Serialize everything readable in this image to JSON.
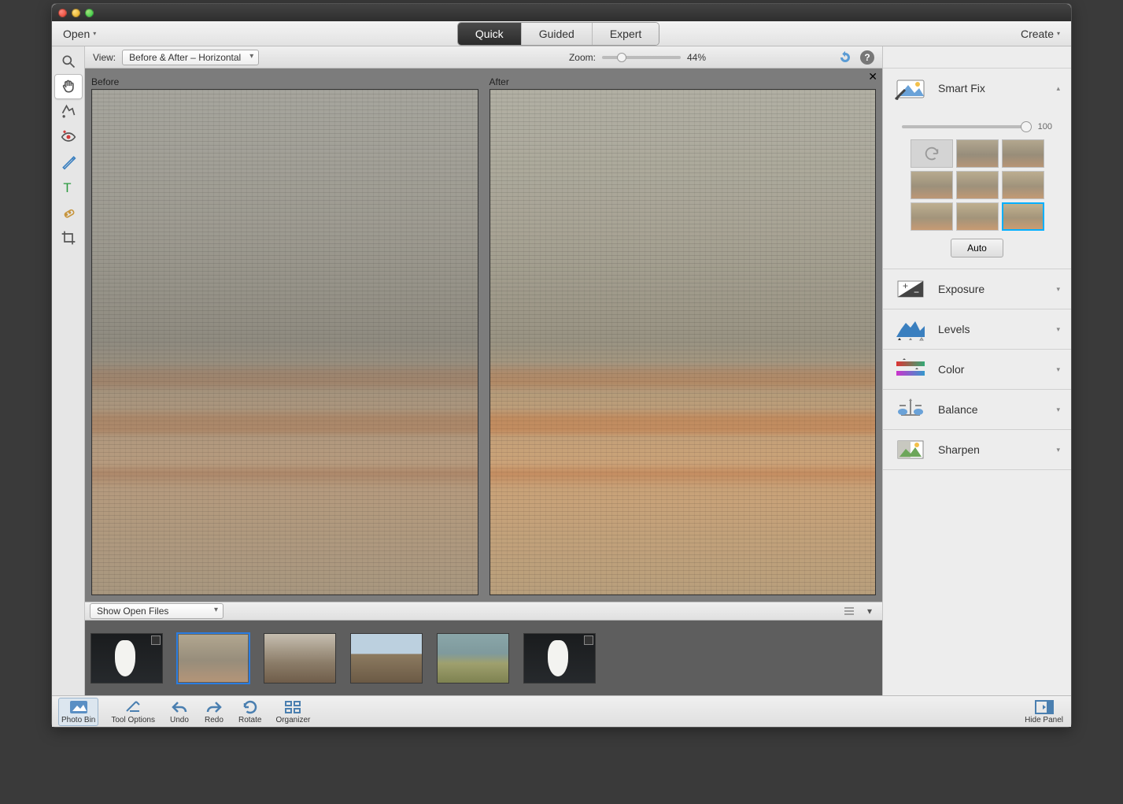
{
  "titlebar": {},
  "menubar": {
    "open_label": "Open",
    "create_label": "Create",
    "mode_tabs": {
      "quick": "Quick",
      "guided": "Guided",
      "expert": "Expert"
    }
  },
  "options_bar": {
    "view_label": "View:",
    "view_value": "Before & After – Horizontal",
    "zoom_label": "Zoom:",
    "zoom_value": "44%"
  },
  "doc": {
    "before_label": "Before",
    "after_label": "After"
  },
  "photo_bin_bar": {
    "filter_value": "Show Open Files"
  },
  "adjustments": {
    "smart_fix": {
      "label": "Smart Fix",
      "slider_value": "100",
      "auto_label": "Auto"
    },
    "exposure": {
      "label": "Exposure"
    },
    "levels": {
      "label": "Levels"
    },
    "color": {
      "label": "Color"
    },
    "balance": {
      "label": "Balance"
    },
    "sharpen": {
      "label": "Sharpen"
    }
  },
  "bottom_bar": {
    "photo_bin": "Photo Bin",
    "tool_options": "Tool Options",
    "undo": "Undo",
    "redo": "Redo",
    "rotate": "Rotate",
    "organizer": "Organizer",
    "hide_panel": "Hide Panel"
  }
}
